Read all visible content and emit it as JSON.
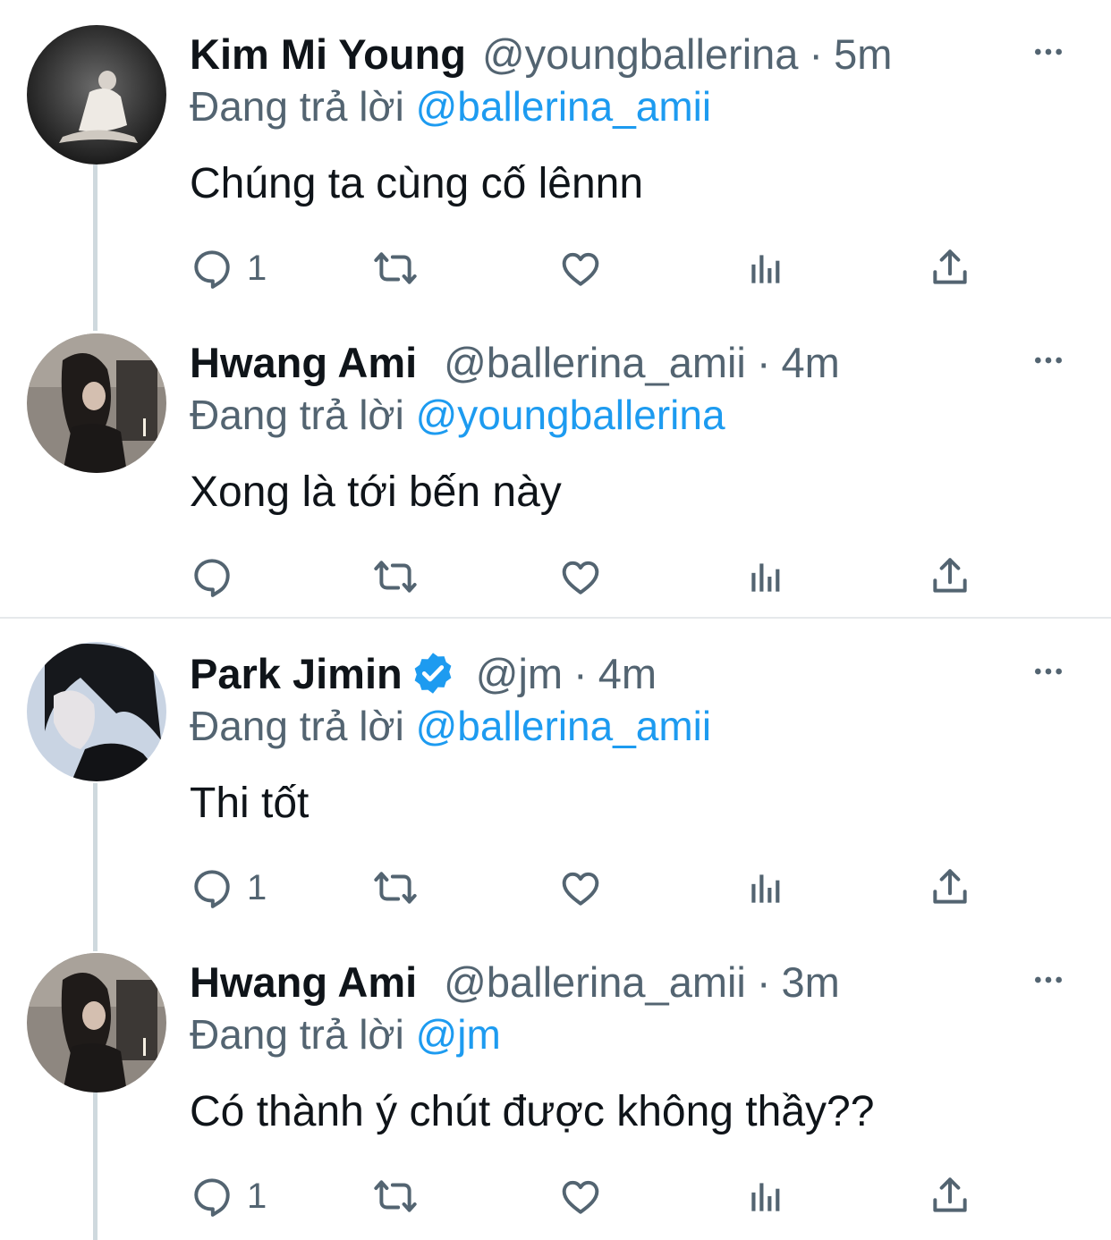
{
  "colors": {
    "accent": "#1d9bf0",
    "secondary": "#536471",
    "text": "#0f1419",
    "thread_line": "#cfd9de"
  },
  "icons": {
    "reply": "reply-icon",
    "retweet": "retweet-icon",
    "like": "heart-icon",
    "views": "views-icon",
    "share": "share-icon",
    "more": "more-icon",
    "verified": "verified-badge-icon"
  },
  "tweets": [
    {
      "name": "Kim Mi Young",
      "handle": "@youngballerina",
      "dot": "·",
      "time": "5m",
      "replying_label": "Đang trả lời",
      "replying_to": "@ballerina_amii",
      "text": "Chúng ta cùng cố lênnn",
      "reply_count": "1"
    },
    {
      "name": "Hwang Ami",
      "handle": "@ballerina_amii",
      "dot": "·",
      "time": "4m",
      "replying_label": "Đang trả lời",
      "replying_to": "@youngballerina",
      "text": "Xong là tới bến này",
      "reply_count": ""
    },
    {
      "name": "Park Jimin",
      "handle": "@jm",
      "dot": "·",
      "time": "4m",
      "replying_label": "Đang trả lời",
      "replying_to": "@ballerina_amii",
      "text": "Thi tốt",
      "reply_count": "1"
    },
    {
      "name": "Hwang Ami",
      "handle": "@ballerina_amii",
      "dot": "·",
      "time": "3m",
      "replying_label": "Đang trả lời",
      "replying_to": "@jm",
      "text": "Có thành ý chút được không thầy??",
      "reply_count": "1"
    }
  ]
}
